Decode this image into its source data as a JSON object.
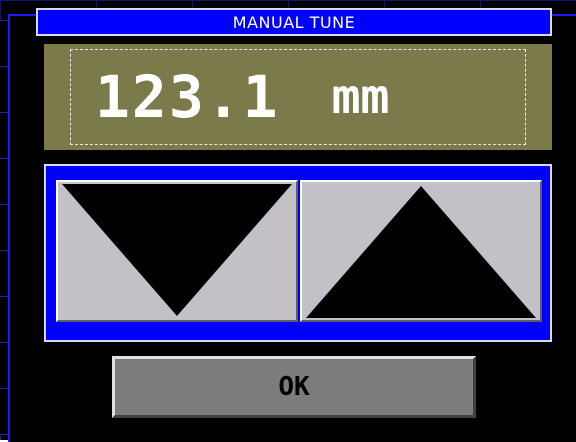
{
  "dialog": {
    "title": "MANUAL TUNE"
  },
  "readout": {
    "value": "123.1",
    "unit": "mm"
  },
  "controls": {
    "down_icon": "triangle-down-icon",
    "up_icon": "triangle-up-icon"
  },
  "actions": {
    "ok_label": "OK"
  },
  "colors": {
    "title_bar": "#0000ff",
    "readout_bg": "#7a7a4a",
    "panel_bg": "#0000ff",
    "button_face": "#c4c0c8",
    "ok_face": "#7c7c7c"
  }
}
